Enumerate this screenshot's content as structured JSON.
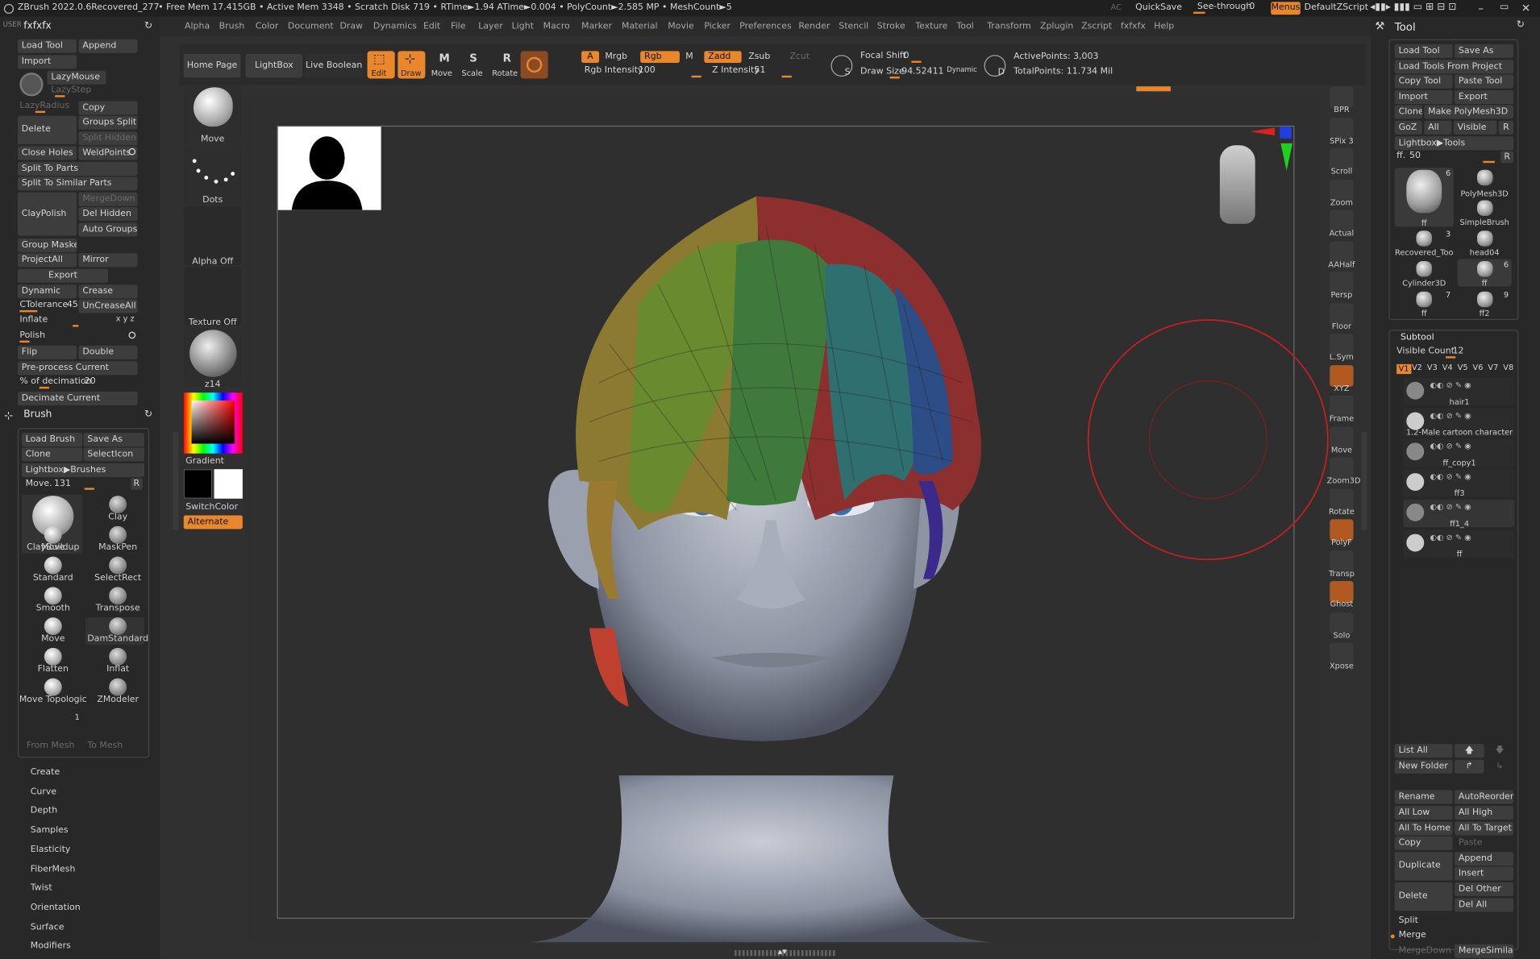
{
  "topbar": {
    "app": "ZBrush 2022.0.6",
    "file": "Recovered_277",
    "stats": "• Free Mem 17.415GB • Active Mem 3348 • Scratch Disk 719 • RTime►1.94 ATime►0.004 • PolyCount►2.585 MP • MeshCount►5",
    "ac": "AC",
    "quicksave": "QuickSave",
    "seethrough": "See-through",
    "seethrough_val": "0",
    "menus": "Menus",
    "script": "DefaultZScript"
  },
  "menubar": [
    "Alpha",
    "Brush",
    "Color",
    "Document",
    "Draw",
    "Dynamics",
    "Edit",
    "File",
    "Layer",
    "Light",
    "Macro",
    "Marker",
    "Material",
    "Movie",
    "Picker",
    "Preferences",
    "Render",
    "Stencil",
    "Stroke",
    "Texture",
    "Tool",
    "Transform",
    "Zplugin",
    "Zscript",
    "fxfxfx",
    "Help"
  ],
  "left": {
    "user": "USER",
    "title": "fxfxfx",
    "load_tool": "Load Tool",
    "append": "Append",
    "import": "Import",
    "lazymouse": "LazyMouse",
    "lazystep": "LazyStep",
    "lazyradius": "LazyRadius",
    "copy": "Copy",
    "delete": "Delete",
    "groups_split": "Groups Split",
    "split_hidden": "Split Hidden",
    "close_holes": "Close Holes",
    "weldpoints": "WeldPoints",
    "split_to_parts": "Split To Parts",
    "split_similar": "Split To Similar Parts",
    "mergedown": "MergeDown",
    "claypolish": "ClayPolish",
    "del_hidden": "Del Hidden",
    "auto_groups": "Auto Groups",
    "group_masked": "Group Masked",
    "projectall": "ProjectAll",
    "mirror": "Mirror",
    "export": "Export",
    "dynamic": "Dynamic",
    "crease": "Crease",
    "ctolerance": "CTolerance",
    "ctolerance_val": "45",
    "uncreaseall": "UnCreaseAll",
    "inflate": "Inflate",
    "inflate_axes": "x y z",
    "polish": "Polish",
    "flip": "Flip",
    "double": "Double",
    "preprocess": "Pre-process Current",
    "decimation": "% of decimation",
    "decimation_val": "20",
    "decimate_current": "Decimate Current"
  },
  "brush": {
    "title": "Brush",
    "load_brush": "Load Brush",
    "save_as": "Save As",
    "clone": "Clone",
    "selecticon": "SelectIcon",
    "lightbox": "Lightbox▶Brushes",
    "move_label": "Move.",
    "move_val": "131",
    "r": "R",
    "items": [
      "Move",
      "Clay",
      "ClayBuildup",
      "MaskPen",
      "Standard",
      "SelectRect",
      "Smooth",
      "Transpose",
      "Move",
      "DamStandard",
      "Flatten",
      "Inflat",
      "Move Topologic",
      "ZModeler"
    ],
    "zmodeler_count": "1",
    "from_mesh": "From Mesh",
    "to_mesh": "To Mesh"
  },
  "subpalettes": [
    "Create",
    "Curve",
    "Depth",
    "Samples",
    "Elasticity",
    "FiberMesh",
    "Twist",
    "Orientation",
    "Surface",
    "Modifiers"
  ],
  "shelf": {
    "move": "Move",
    "dots": "Dots",
    "alpha_off": "Alpha Off",
    "texture_off": "Texture Off",
    "material": "z14",
    "gradient": "Gradient",
    "switchcolor": "SwitchColor",
    "alternate": "Alternate"
  },
  "toolbar": {
    "home": "Home Page",
    "lightbox": "LightBox",
    "live_boolean": "Live Boolean",
    "edit": "Edit",
    "draw": "Draw",
    "move": "Move",
    "scale": "Scale",
    "rotate": "Rotate",
    "a": "A",
    "mrgb": "Mrgb",
    "rgb": "Rgb",
    "m": "M",
    "zadd": "Zadd",
    "zsub": "Zsub",
    "zcut": "Zcut",
    "rgb_intensity": "Rgb Intensity",
    "rgb_intensity_val": "100",
    "z_intensity": "Z Intensity",
    "z_intensity_val": "51",
    "focal_shift": "Focal Shift",
    "focal_shift_val": "0",
    "draw_size": "Draw Size",
    "draw_size_val": "94.52411",
    "dynamic": "Dynamic",
    "active_points": "ActivePoints: 3,003",
    "total_points": "TotalPoints: 11.734 Mil",
    "s": "S",
    "d": "D"
  },
  "rightshelf": [
    "BPR",
    "SPix 3",
    "Scroll",
    "Zoom",
    "Actual",
    "AAHalf",
    "Persp",
    "Floor",
    "L.Sym",
    "XYZ",
    "Frame",
    "Move",
    "Zoom3D",
    "Rotate",
    "PolyF",
    "Transp",
    "Ghost",
    "Solo",
    "Xpose"
  ],
  "tool": {
    "title": "Tool",
    "load_tool": "Load Tool",
    "save_as": "Save As",
    "load_from_project": "Load Tools From Project",
    "copy_tool": "Copy Tool",
    "paste_tool": "Paste Tool",
    "import": "Import",
    "export": "Export",
    "clone": "Clone",
    "make_polymesh": "Make PolyMesh3D",
    "goz": "GoZ",
    "all": "All",
    "visible": "Visible",
    "r": "R",
    "lightbox_tools": "Lightbox▶Tools",
    "ff_label": "ff.",
    "ff_val": "50",
    "thumbs": [
      {
        "name": "ff",
        "count": "6"
      },
      {
        "name": "PolyMesh3D",
        "count": ""
      },
      {
        "name": "SimpleBrush",
        "count": ""
      },
      {
        "name": "Recovered_Too",
        "count": "3"
      },
      {
        "name": "head04",
        "count": ""
      },
      {
        "name": "Cylinder3D",
        "count": ""
      },
      {
        "name": "ff",
        "count": "6"
      },
      {
        "name": "ff",
        "count": "7"
      },
      {
        "name": "ff2",
        "count": "9"
      }
    ]
  },
  "subtool": {
    "title": "Subtool",
    "visible_count": "Visible Count",
    "visible_count_val": "12",
    "versions": [
      "V1",
      "V2",
      "V3",
      "V4",
      "V5",
      "V6",
      "V7",
      "V8"
    ],
    "items": [
      "hair1",
      "1.2-Male cartoon character",
      "ff_copy1",
      "ff3",
      "ff1_4",
      "ff"
    ],
    "list_all": "List All",
    "new_folder": "New Folder",
    "rename": "Rename",
    "autoreorder": "AutoReorder",
    "all_low": "All Low",
    "all_high": "All High",
    "all_to_home": "All To Home",
    "all_to_target": "All To Target",
    "copy": "Copy",
    "paste": "Paste",
    "duplicate": "Duplicate",
    "append": "Append",
    "insert": "Insert",
    "delete": "Delete",
    "del_other": "Del Other",
    "del_all": "Del All",
    "split": "Split",
    "merge": "Merge",
    "mergedown": "MergeDown",
    "mergesimilar": "MergeSimilar"
  },
  "colors": {
    "accent": "#e8872c",
    "panel": "#2b2b2b",
    "button": "#3d3d3d",
    "canvas": "#2f2f2f"
  }
}
